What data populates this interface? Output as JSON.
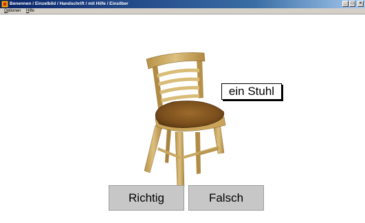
{
  "window": {
    "title": "Benennen / Einzelbild / Handschrift / mit Hilfe / Einsilber",
    "minimize_icon": "minimize-icon",
    "maximize_icon": "maximize-icon",
    "close_icon": "close-icon"
  },
  "menu": {
    "items": [
      {
        "prefix": "O",
        "rest": "ptionen"
      },
      {
        "prefix": "H",
        "rest": "ilfe"
      }
    ]
  },
  "main": {
    "image_icon": "chair-icon",
    "word": "ein Stuhl",
    "buttons": {
      "correct_label": "Richtig",
      "wrong_label": "Falsch"
    }
  },
  "colors": {
    "titlebar_start": "#0a246a",
    "titlebar_end": "#a6caf0",
    "button_face": "#c7c7c7",
    "chair_wood": "#c9a45a",
    "chair_seat": "#7a4e1c"
  }
}
